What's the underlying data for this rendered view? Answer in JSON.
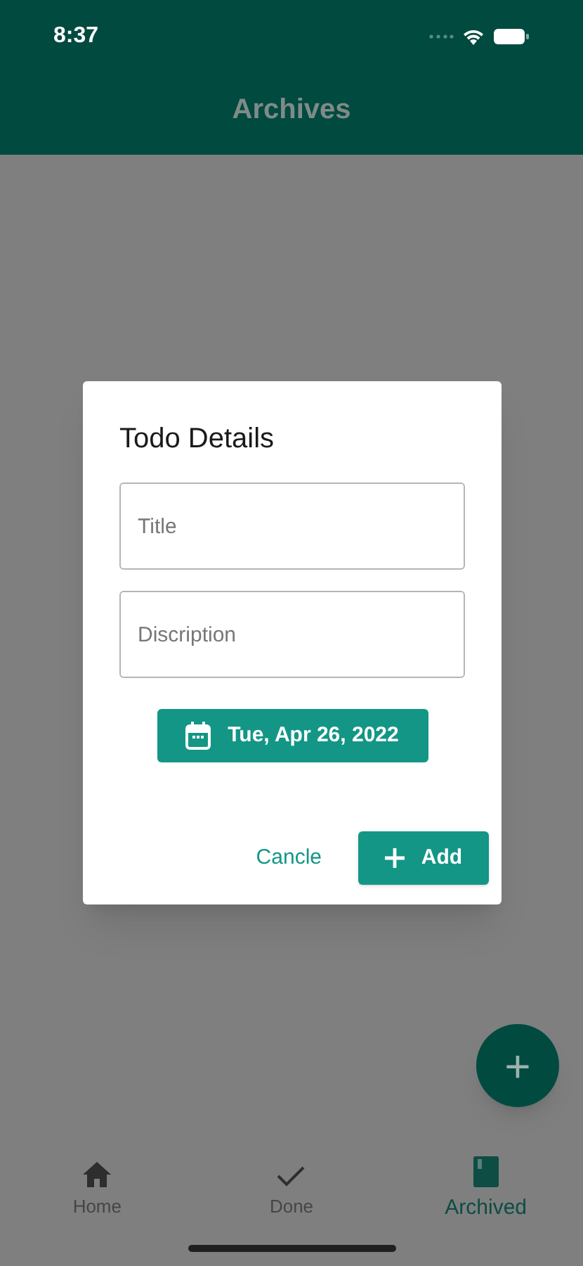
{
  "status_bar": {
    "time": "8:37"
  },
  "app_bar": {
    "title": "Archives"
  },
  "dialog": {
    "title": "Todo Details",
    "fields": [
      {
        "placeholder": "Title"
      },
      {
        "placeholder": "Discription"
      }
    ],
    "date_button": "Tue, Apr 26, 2022",
    "cancel_button": "Cancle",
    "add_button": "Add"
  },
  "fab": {
    "label": "+"
  },
  "bottom_nav": [
    {
      "kind": "home",
      "label": "Home",
      "selected": false
    },
    {
      "kind": "check",
      "label": "Done",
      "selected": false
    },
    {
      "kind": "book",
      "label": "Archived",
      "selected": true
    }
  ]
}
